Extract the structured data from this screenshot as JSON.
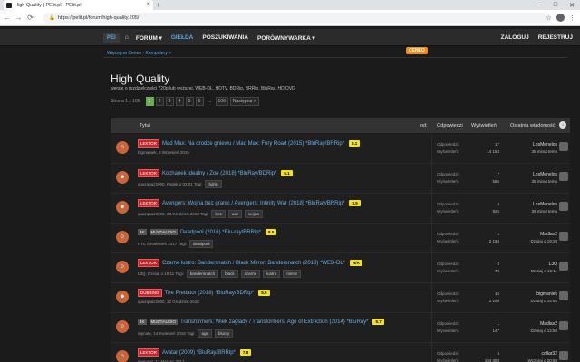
{
  "browser": {
    "tab_title": "High Quality | PElit.pl - PElit.pl",
    "tab_close": "×",
    "new_tab": "+",
    "url": "https://pelit.pl/forum/high-quality.205/",
    "back": "←",
    "forward": "→",
    "reload": "⟳",
    "win_min": "—",
    "win_max": "□",
    "win_close": "✕",
    "star": "☆",
    "menu": "⋮"
  },
  "nav": {
    "logo": "PEl",
    "home": "⌂",
    "items": [
      "FORUM ▾",
      "GIEŁDA",
      "POSZUKIWANIA",
      "PORÓWNYWARKA ▾"
    ],
    "login": "ZALOGUJ",
    "register": "REJESTRUJ"
  },
  "breadcrumb": "Więcej na Ceneo - Komputery »",
  "ceneo": "CENEO",
  "ceneo_mark": "’",
  "header": {
    "title": "High Quality",
    "subtitle": "wersje o rozdzielczości 720p lub wyższej, WEB-DL, HDTV, BDRip, BRRip, BluRay, HD DVD"
  },
  "pager": {
    "label": "Strona 1 z 106",
    "pages": [
      "1",
      "2",
      "3",
      "4",
      "5",
      "6",
      "...",
      "106",
      "Następna >"
    ]
  },
  "table": {
    "columns": {
      "topic": "Tytuł",
      "od": "od:",
      "replies": "Odpowiedzi",
      "views": "Wyświetleń",
      "last": "Ostatnia wiadomość",
      "sort": "↓"
    },
    "rows": [
      {
        "avatar": "☺",
        "tags": [
          "LEKTOR"
        ],
        "title": "Mad Max: Na drodze gniewu / Mad Max: Fury Road (2015) *BluRay/BRRip*",
        "rating": "8.1",
        "meta": "bigmaniek, 8 Wrzesień 2015",
        "chips": [],
        "rep_label": "Odpowiedzi:",
        "views_label": "Wyświetleń:",
        "replies": "17",
        "views": "14 154",
        "last_user": "LosMenelos",
        "last_time": "35 minut temu"
      },
      {
        "avatar": "☻",
        "tags": [
          "LEKTOR"
        ],
        "title": "Kochanek idealny / Zoe (2018) *BluRay/BDRip*",
        "rating": "6.1",
        "meta": "quazquaz2000, Piątek o 02:01 Tagi:",
        "chips": [
          "bdrip"
        ],
        "rep_label": "Odpowiedzi:",
        "views_label": "Wyświetleń:",
        "replies": "7",
        "views": "585",
        "last_user": "LosMenelos",
        "last_time": "35 minut temu"
      },
      {
        "avatar": "☻",
        "tags": [
          "LEKTOR"
        ],
        "title": "Avengers: Wojna bez granic / Avengers: Infinity War (2018) *BluRay/BRRip*",
        "rating": "8.5",
        "meta": "quazquaz2000, 23 Grudzień 2018 Tagi:",
        "chips": [
          "bez",
          "war",
          "wojna"
        ],
        "rep_label": "Odpowiedzi:",
        "views_label": "Wyświetleń:",
        "replies": "4",
        "views": "825",
        "last_user": "LosMenelos",
        "last_time": "35 minut temu"
      },
      {
        "avatar": "☺",
        "tags": [
          "4K",
          "MULTIAUDIO"
        ],
        "title": "Deadpool (2016) *Blu-ray/BRRip*",
        "rating": "8.0",
        "meta": "HTs, 8 Kwiecień 2017 Tagi:",
        "chips": [
          "deadpool"
        ],
        "rep_label": "Odpowiedzi:",
        "views_label": "Wyświetleń:",
        "replies": "2",
        "views": "2 194",
        "last_user": "Madlax2",
        "last_time": "Dzisiaj o 19:28"
      },
      {
        "avatar": "☺",
        "tags": [
          "LEKTOR"
        ],
        "title": "Czarne lustro: Bandersnatch / Black Mirror: Bandersnatch (2018) *WEB-DL*",
        "rating": "N/A",
        "meta": "L3Q, Dzisiaj o 19:11 Tagi:",
        "chips": [
          "bandersnatch",
          "black",
          "czarne",
          "lustro",
          "mirror"
        ],
        "rep_label": "Odpowiedzi:",
        "views_label": "Wyświetleń:",
        "replies": "0",
        "views": "73",
        "last_user": "L3Q",
        "last_time": "Dzisiaj o 19:11"
      },
      {
        "avatar": "☻",
        "tags": [
          "DUBBING"
        ],
        "title": "The Predator (2018) *BluRay/BDRip*",
        "rating": "5.6",
        "meta": "quazquaz2000, 12 Grudzień 2018",
        "chips": [],
        "rep_label": "Odpowiedzi:",
        "views_label": "Wyświetleń:",
        "replies": "16",
        "views": "2 150",
        "last_user": "bigmaniek",
        "last_time": "Dzisiaj o 14:55"
      },
      {
        "avatar": "☺",
        "tags": [
          "4K",
          "MULTIAUDIO"
        ],
        "title": "Transformers: Wiek zagłady / Transformers: Age of Extinction (2014) *BluRay*",
        "rating": "5.7",
        "meta": "mpcate, 14 Kwiecień 2018 Tagi:",
        "chips": [
          "age",
          "bluray"
        ],
        "rep_label": "Odpowiedzi:",
        "views_label": "Wyświetleń:",
        "replies": "1",
        "views": "147",
        "last_user": "Madlax2",
        "last_time": "Dzisiaj o 12:50"
      },
      {
        "avatar": "☺",
        "tags": [
          "LEKTOR"
        ],
        "title": "Avatar (2009) *BluRay/BRRip*",
        "rating": "7.8",
        "meta": "sienoust, 17 Marzec 2017",
        "chips": [],
        "rep_label": "Odpowiedzi:",
        "views_label": "Wyświetleń:",
        "replies": "4",
        "views": "194 393",
        "last_user": "collar32",
        "last_time": "Wczoraj o 20:59"
      }
    ]
  }
}
